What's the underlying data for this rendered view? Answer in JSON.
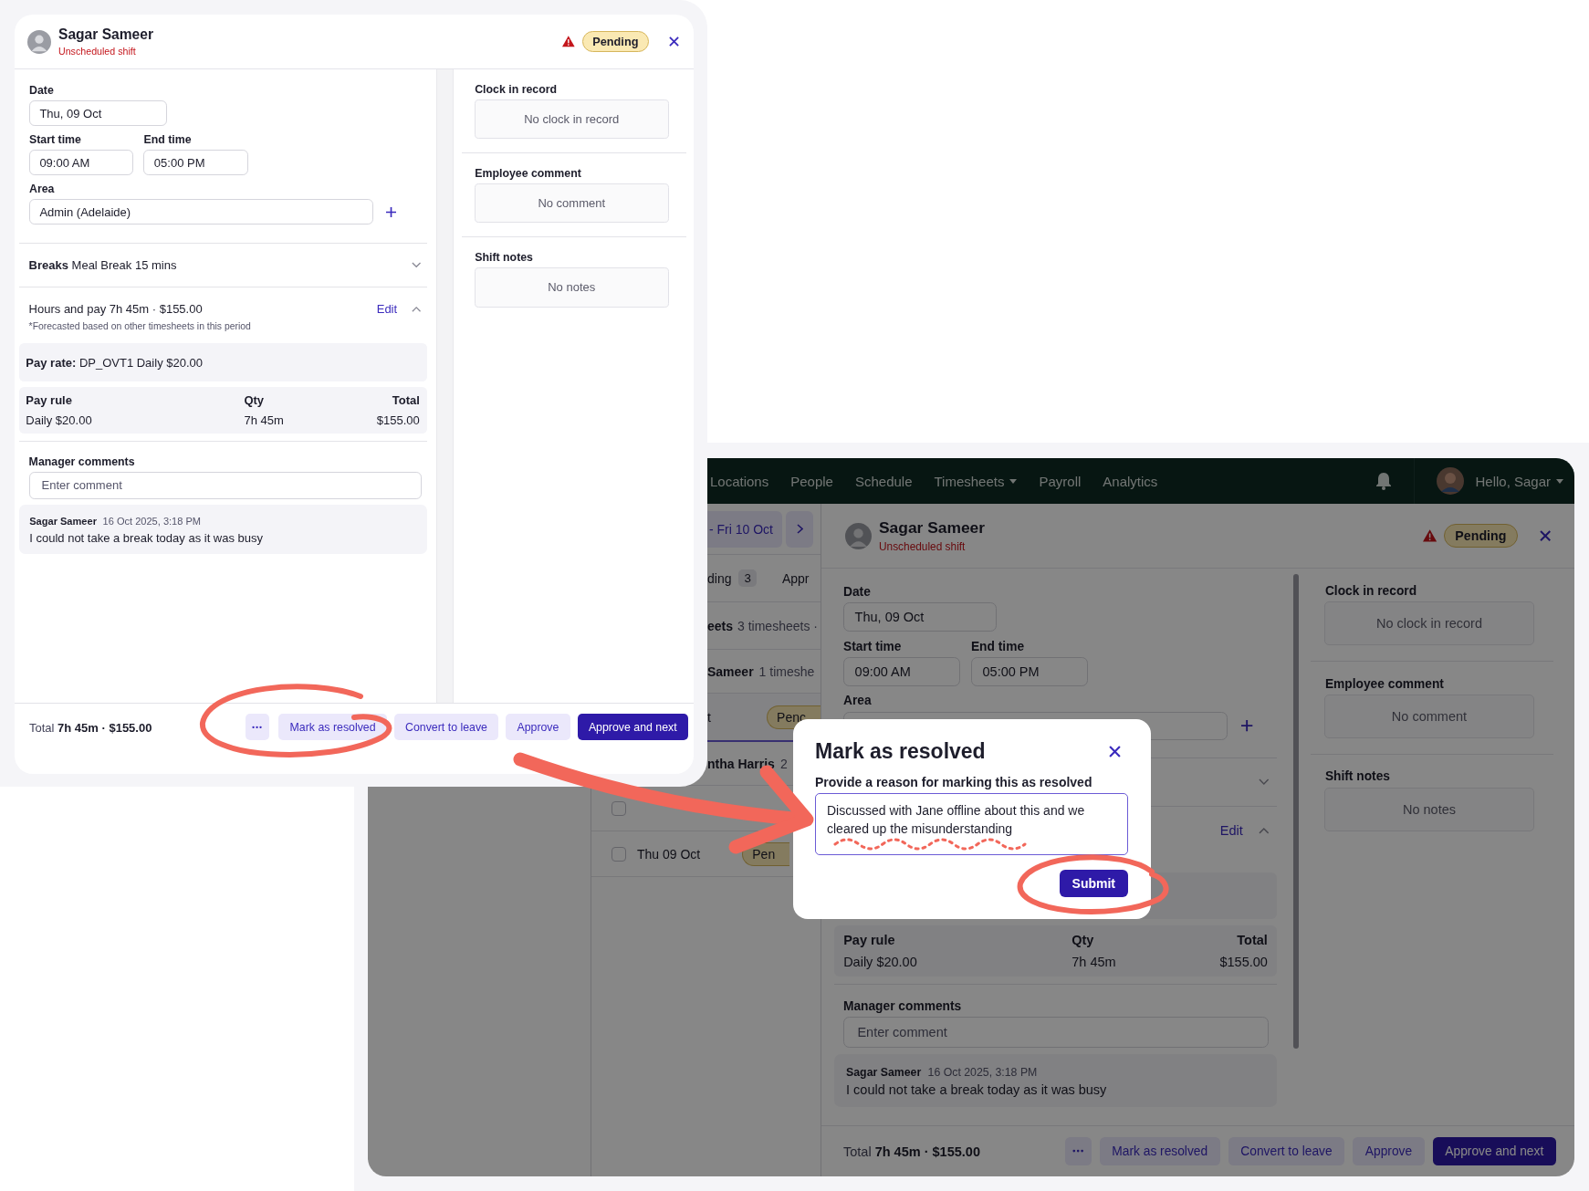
{
  "top_card": {
    "header": {
      "name": "Sagar Sameer",
      "subtitle": "Unscheduled shift",
      "status": "Pending",
      "warning": true
    },
    "form": {
      "date_label": "Date",
      "date": "Thu, 09 Oct",
      "start_label": "Start time",
      "start": "09:00 AM",
      "end_label": "End time",
      "end": "05:00 PM",
      "area_label": "Area",
      "area": "Admin (Adelaide)"
    },
    "breaks": {
      "title": "**Breaks** Meal Break 15 mins",
      "expanded": false
    },
    "hours": {
      "title": "Hours and pay 7h 45m · $155.00",
      "edit": "Edit",
      "expanded": true,
      "note": "*Forecasted based on other timesheets in this period"
    },
    "pay_rate": "**Pay rate:** DP_OVT1 Daily $20.00",
    "pay_table": {
      "columns": [
        "Pay rule",
        "Qty",
        "Total"
      ],
      "rows": [
        [
          "Daily $20.00",
          "7h 45m",
          "$155.00"
        ]
      ]
    },
    "manager_comments": {
      "label": "Manager comments",
      "placeholder": "Enter comment",
      "comments": [
        {
          "author": "Sagar Sameer",
          "time": "16 Oct 2025, 3:18 PM",
          "text": "I could not take a break today as it was busy"
        }
      ]
    },
    "side": [
      {
        "label": "Clock in record",
        "value": "No clock in record"
      },
      {
        "label": "Employee comment",
        "value": "No comment"
      },
      {
        "label": "Shift notes",
        "value": "No notes"
      }
    ],
    "footer": {
      "total": "Total **7h 45m · $155.00**",
      "buttons": [
        {
          "kind": "more"
        },
        {
          "kind": "secondary",
          "label": "Mark as resolved"
        },
        {
          "kind": "secondary",
          "label": "Convert to leave"
        },
        {
          "kind": "secondary",
          "label": "Approve"
        },
        {
          "kind": "primary",
          "label": "Approve and next"
        }
      ]
    }
  },
  "bottom_app": {
    "nav": {
      "items": [
        {
          "label": "Locations",
          "dropdown": false
        },
        {
          "label": "People",
          "dropdown": false
        },
        {
          "label": "Schedule",
          "dropdown": false
        },
        {
          "label": "Timesheets",
          "dropdown": true
        },
        {
          "label": "Payroll",
          "dropdown": false
        },
        {
          "label": "Analytics",
          "dropdown": false
        }
      ],
      "greeting": "Hello, Sagar"
    },
    "list": {
      "date_range": "- Fri 10 Oct",
      "tabs": [
        {
          "label": "ding",
          "count": "3"
        },
        {
          "label": "Appr"
        }
      ],
      "rows": [
        {
          "kind": "group",
          "title": "eets",
          "meta": "3 timesheets ·"
        },
        {
          "kind": "person",
          "title": "Sameer",
          "meta": "1 timeshe"
        },
        {
          "kind": "shift",
          "title": "t",
          "status": "Penc",
          "selected": true
        },
        {
          "kind": "person",
          "title": "ntha Harris",
          "meta": "2"
        },
        {
          "kind": "check",
          "checked": false
        },
        {
          "kind": "check",
          "title": "Thu 09 Oct",
          "status": "Pen",
          "checked": false
        }
      ]
    },
    "detail": {
      "header": {
        "name": "Sagar Sameer",
        "subtitle": "Unscheduled shift",
        "status": "Pending",
        "warning": true
      },
      "form": {
        "date_label": "Date",
        "date": "Thu, 09 Oct",
        "start_label": "Start time",
        "start": "09:00 AM",
        "end_label": "End time",
        "end": "05:00 PM",
        "area_label": "Area"
      },
      "breaks": {
        "expanded": false
      },
      "hours": {
        "edit": "Edit",
        "expanded": true
      },
      "pay_table": {
        "columns": [
          "Pay rule",
          "Qty",
          "Total"
        ],
        "rows": [
          [
            "Daily $20.00",
            "7h 45m",
            "$155.00"
          ]
        ]
      },
      "manager_comments": {
        "label": "Manager comments",
        "placeholder": "Enter comment",
        "comments": [
          {
            "author": "Sagar Sameer",
            "time": "16 Oct 2025, 3:18 PM",
            "text": "I could not take a break today as it was busy"
          }
        ]
      },
      "side": [
        {
          "label": "Clock in record",
          "value": "No clock in record"
        },
        {
          "label": "Employee comment",
          "value": "No comment"
        },
        {
          "label": "Shift notes",
          "value": "No notes"
        }
      ],
      "footer": {
        "total": "Total **7h 45m · $155.00**",
        "buttons": [
          {
            "kind": "more"
          },
          {
            "kind": "secondary",
            "label": "Mark as resolved"
          },
          {
            "kind": "secondary",
            "label": "Convert to leave"
          },
          {
            "kind": "secondary",
            "label": "Approve"
          },
          {
            "kind": "primary",
            "label": "Approve and next"
          }
        ]
      }
    },
    "modal": {
      "title": "Mark as resolved",
      "label": "Provide a reason for marking this as resolved",
      "value": "Discussed with Jane offline about this and we cleared up the misunderstanding",
      "submit": "Submit"
    }
  }
}
